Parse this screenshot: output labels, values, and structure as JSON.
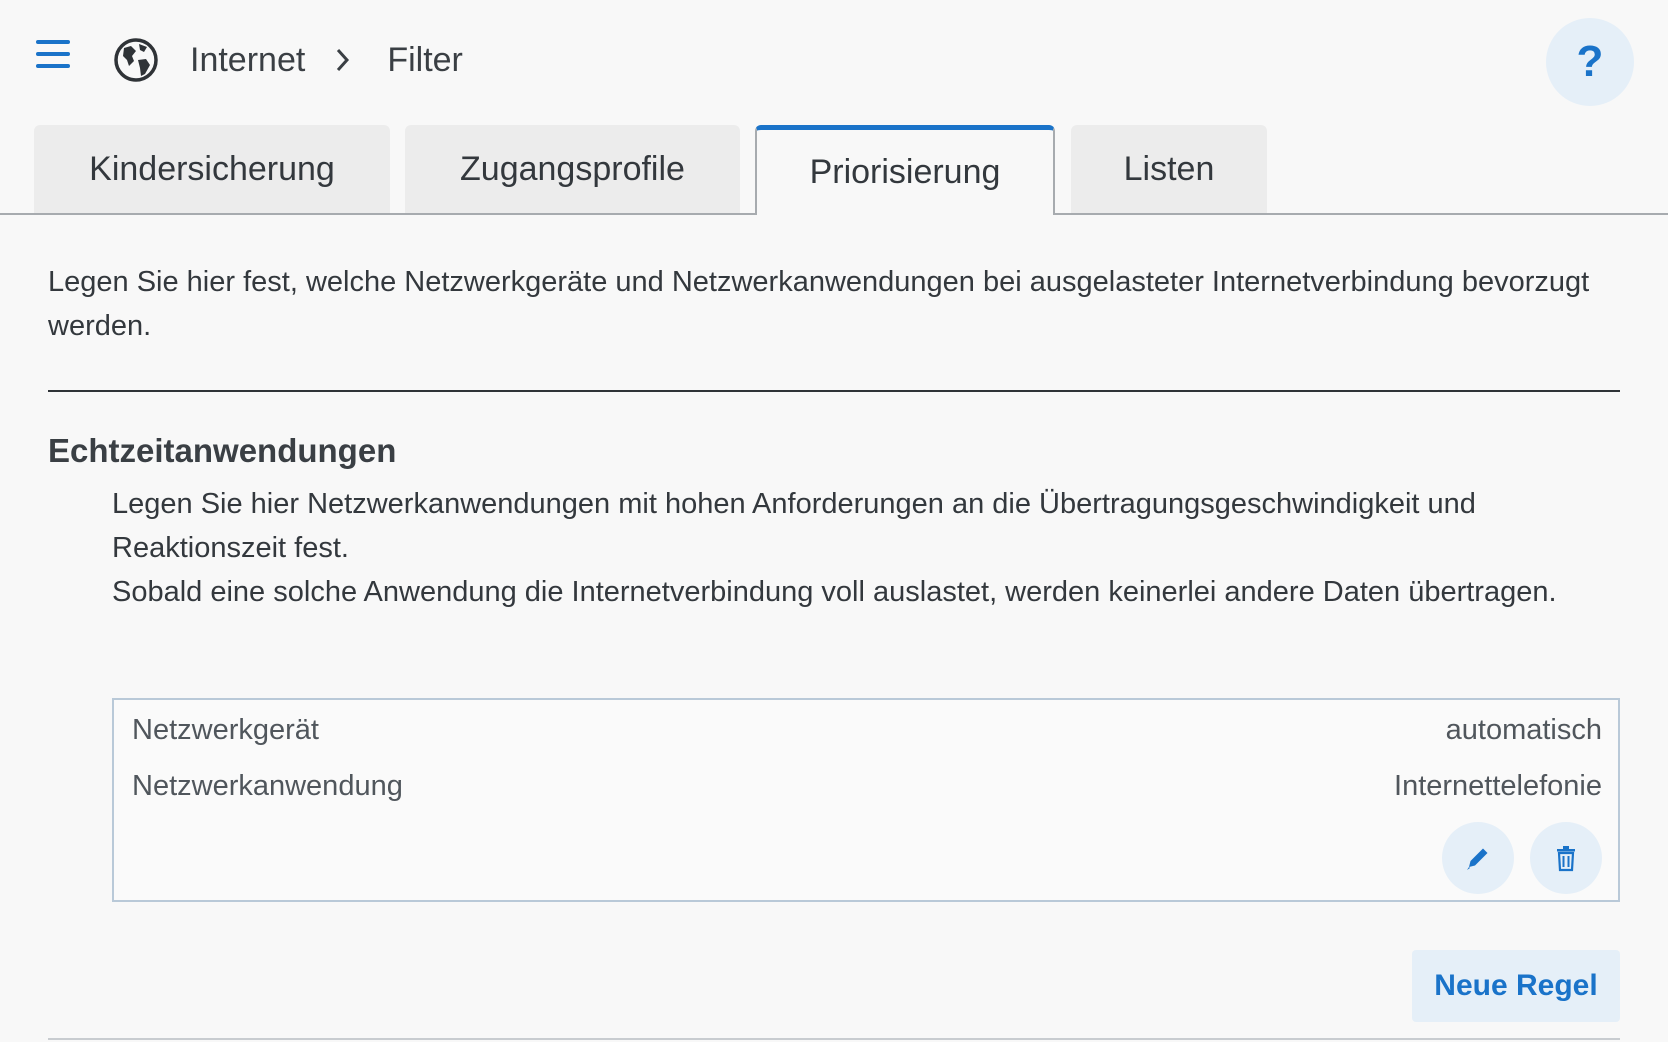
{
  "header": {
    "breadcrumb": [
      "Internet",
      "Filter"
    ],
    "help_label": "?"
  },
  "tabs": [
    {
      "label": "Kindersicherung",
      "active": false
    },
    {
      "label": "Zugangsprofile",
      "active": false
    },
    {
      "label": "Priorisierung",
      "active": true
    },
    {
      "label": "Listen",
      "active": false
    }
  ],
  "intro": "Legen Sie hier fest, welche Netzwerkgeräte und Netzwerkanwendungen bei ausgelasteter Internetverbindung bevorzugt werden.",
  "section": {
    "title": "Echtzeitanwendungen",
    "description": [
      "Legen Sie hier Netzwerkanwendungen mit hohen Anforderungen an die Übertragungsgeschwindigkeit und Reaktionszeit fest.",
      "Sobald eine solche Anwendung die Internetverbindung voll auslastet, werden keinerlei andere Daten übertragen."
    ],
    "rule": {
      "rows": [
        {
          "label": "Netzwerkgerät",
          "value": "automatisch"
        },
        {
          "label": "Netzwerkanwendung",
          "value": "Internettelefonie"
        }
      ]
    },
    "new_rule_label": "Neue Regel"
  },
  "colors": {
    "accent": "#1a73c9",
    "button_bg": "#e5eff8",
    "tab_bg": "#ececec"
  },
  "icons": [
    "menu-icon",
    "globe-icon",
    "chevron-right-icon",
    "pencil-icon",
    "trash-icon"
  ]
}
